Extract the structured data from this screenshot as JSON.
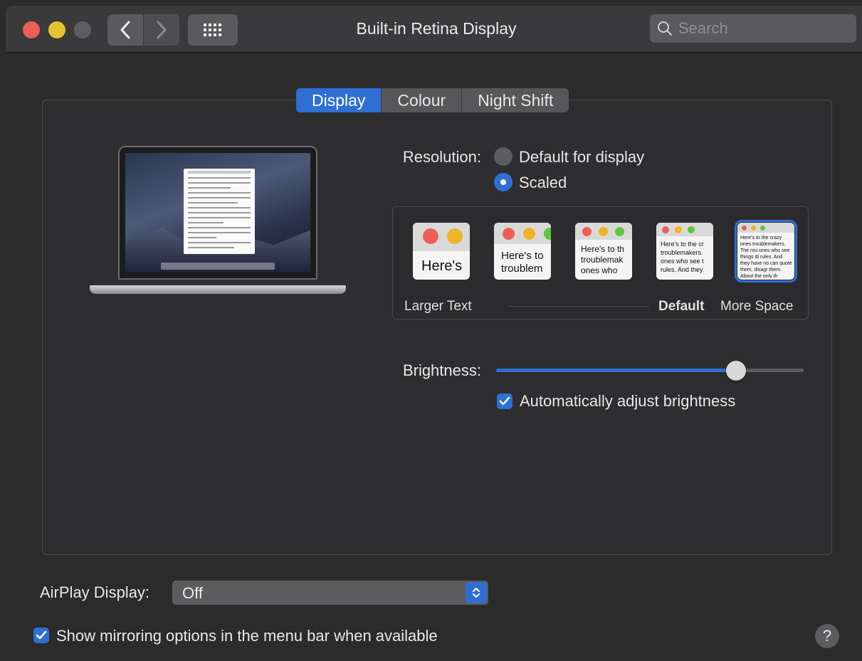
{
  "window": {
    "title": "Built-in Retina Display",
    "search_placeholder": "Search"
  },
  "tabs": [
    {
      "label": "Display",
      "active": true
    },
    {
      "label": "Colour",
      "active": false
    },
    {
      "label": "Night Shift",
      "active": false
    }
  ],
  "resolution": {
    "label": "Resolution:",
    "options": [
      {
        "label": "Default for display",
        "selected": false
      },
      {
        "label": "Scaled",
        "selected": true
      }
    ]
  },
  "scale_options": {
    "thumbnails": [
      {
        "preview_text": "Here's",
        "selected": false
      },
      {
        "preview_text": "Here's to troublem",
        "selected": false
      },
      {
        "preview_text": "Here's to th troublemak ones who",
        "selected": false
      },
      {
        "preview_text": "Here's to the cr troublemakers. ones who see t rules. And they",
        "selected": false
      },
      {
        "preview_text": "Here's to the crazy ones troublemakers. The rou ones who see things di rules. And they have no can quote them, disagr them. About the only th Because they change th",
        "selected": true
      }
    ],
    "labels": {
      "larger": "Larger Text",
      "default": "Default",
      "more": "More Space"
    }
  },
  "brightness": {
    "label": "Brightness:",
    "value": 0.78,
    "auto_label": "Automatically adjust brightness",
    "auto_checked": true
  },
  "airplay": {
    "label": "AirPlay Display:",
    "value": "Off"
  },
  "mirroring": {
    "label": "Show mirroring options in the menu bar when available",
    "checked": true
  },
  "help": {
    "label": "?"
  },
  "colors": {
    "accent": "#2f6fd4",
    "window_bg": "#2b2b2b",
    "titlebar_bg": "#3a3a3c"
  }
}
